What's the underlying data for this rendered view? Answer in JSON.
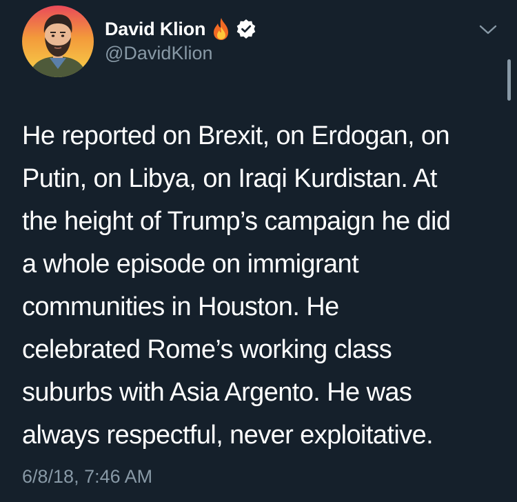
{
  "tweet": {
    "author": {
      "display_name": "David Klion",
      "handle": "@DavidKlion",
      "emoji_icon": "fire-icon",
      "verified_icon": "verified-badge-icon"
    },
    "body_lines": [
      "He reported on Brexit, on Erdogan, on",
      "Putin, on Libya, on Iraqi Kurdistan. At",
      "the height of Trump’s campaign he did",
      "a whole episode on immigrant",
      "communities in Houston. He",
      "celebrated Rome’s working class",
      "suburbs with Asia Argento. He was",
      "always respectful, never exploitative."
    ],
    "timestamp": "6/8/18, 7:46 AM",
    "menu_icon": "chevron-down-icon"
  },
  "colors": {
    "background": "#15202b",
    "text_primary": "#ffffff",
    "text_secondary": "#8899a6",
    "verified_badge": "#ffffff"
  }
}
